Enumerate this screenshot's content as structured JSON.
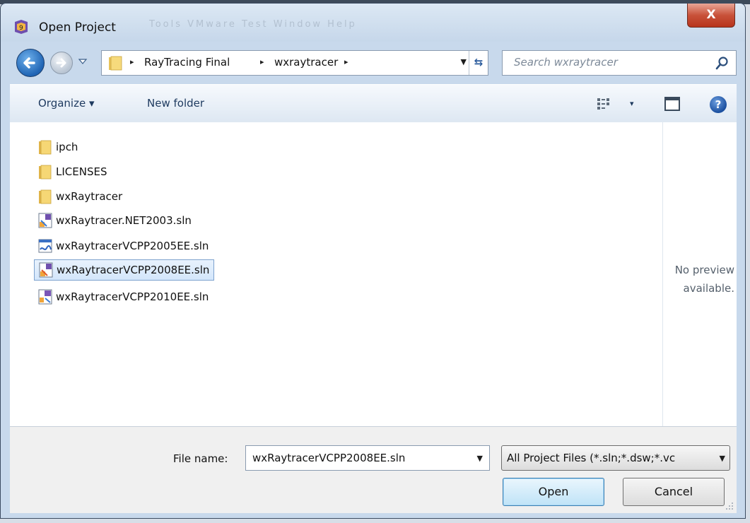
{
  "window": {
    "title": "Open Project",
    "close_label": "X"
  },
  "address": {
    "parts": [
      "RayTracing Final",
      "wxraytracer"
    ],
    "separator": "▸"
  },
  "search": {
    "placeholder": "Search wxraytracer"
  },
  "toolbar": {
    "organize_label": "Organize ▾",
    "new_folder_label": "New folder",
    "view_drop": "▾",
    "help_label": "?"
  },
  "files": [
    {
      "name": "ipch",
      "type": "folder"
    },
    {
      "name": "LICENSES",
      "type": "folder"
    },
    {
      "name": "wxRaytracer",
      "type": "folder"
    },
    {
      "name": "wxRaytracer.NET2003.sln",
      "type": "sln-2003"
    },
    {
      "name": "wxRaytracerVCPP2005EE.sln",
      "type": "sln-2005"
    },
    {
      "name": "wxRaytracerVCPP2008EE.sln",
      "type": "sln-2008",
      "selected": true
    },
    {
      "name": "wxRaytracerVCPP2010EE.sln",
      "type": "sln-2010"
    }
  ],
  "preview": {
    "line1": "No preview",
    "line2": "available."
  },
  "footer": {
    "file_name_label": "File name:",
    "file_name_value": "wxRaytracerVCPP2008EE.sln",
    "file_type_value": "All Project Files (*.sln;*.dsw;*.vc",
    "open_label": "Open",
    "cancel_label": "Cancel"
  },
  "colors": {
    "accent": "#1f64b4",
    "close_red": "#c8523a",
    "selection_border": "#7da2ce"
  }
}
